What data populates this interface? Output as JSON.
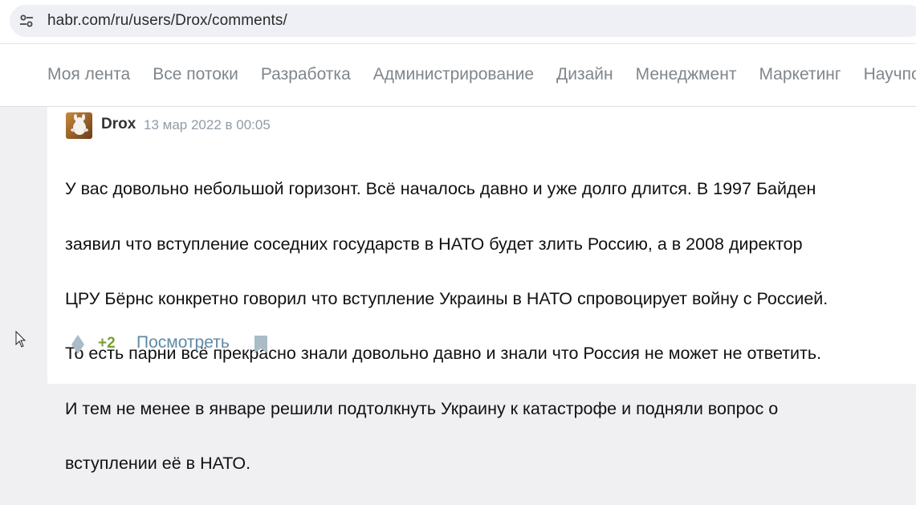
{
  "browser": {
    "url": "habr.com/ru/users/Drox/comments/",
    "site_info_icon": "tune-icon"
  },
  "nav": {
    "items": [
      {
        "label": "Моя лента"
      },
      {
        "label": "Все потоки"
      },
      {
        "label": "Разработка"
      },
      {
        "label": "Администрирование"
      },
      {
        "label": "Дизайн"
      },
      {
        "label": "Менеджмент"
      },
      {
        "label": "Маркетинг"
      },
      {
        "label": "Научпоп"
      }
    ]
  },
  "comment": {
    "author": "Drox",
    "timestamp": "13 мар 2022 в 00:05",
    "lines": [
      "У вас довольно небольшой горизонт. Всё началось давно и уже долго длится. В 1997 Байден",
      "заявил что вступление соседних государств в НАТО будет злить Россию, а в 2008 директор",
      "ЦРУ Бёрнс конкретно говорил что вступление Украины в НАТО спровоцирует войну с Россией.",
      "То есть парни всё прекрасно знали довольно давно и знали что Россия не может не ответить.",
      "И тем не менее в январе решили подтолкнуть Украину к катастрофе и подняли вопрос о",
      "вступлении её в НАТО."
    ],
    "score": "+2",
    "view_label": "Посмотреть"
  },
  "colors": {
    "score_positive": "#7b9e35",
    "link": "#5e8aa6",
    "nav_text": "#80868b",
    "meta_text": "#929ca5"
  }
}
